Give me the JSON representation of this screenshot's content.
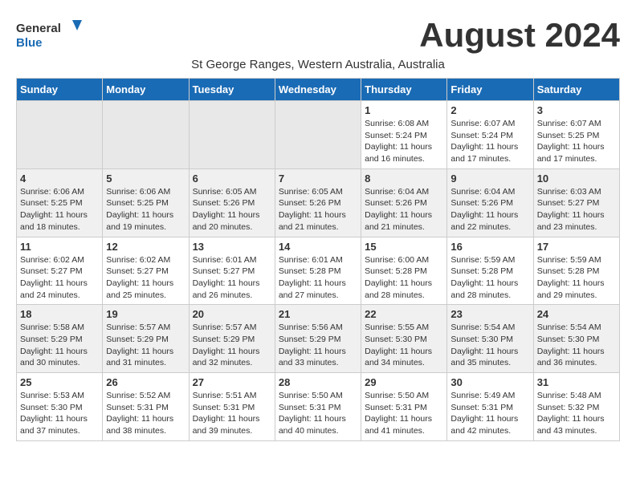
{
  "header": {
    "logo_general": "General",
    "logo_blue": "Blue",
    "month_title": "August 2024",
    "subtitle": "St George Ranges, Western Australia, Australia"
  },
  "days_of_week": [
    "Sunday",
    "Monday",
    "Tuesday",
    "Wednesday",
    "Thursday",
    "Friday",
    "Saturday"
  ],
  "weeks": [
    [
      {
        "day": "",
        "info": ""
      },
      {
        "day": "",
        "info": ""
      },
      {
        "day": "",
        "info": ""
      },
      {
        "day": "",
        "info": ""
      },
      {
        "day": "1",
        "info": "Sunrise: 6:08 AM\nSunset: 5:24 PM\nDaylight: 11 hours\nand 16 minutes."
      },
      {
        "day": "2",
        "info": "Sunrise: 6:07 AM\nSunset: 5:24 PM\nDaylight: 11 hours\nand 17 minutes."
      },
      {
        "day": "3",
        "info": "Sunrise: 6:07 AM\nSunset: 5:25 PM\nDaylight: 11 hours\nand 17 minutes."
      }
    ],
    [
      {
        "day": "4",
        "info": "Sunrise: 6:06 AM\nSunset: 5:25 PM\nDaylight: 11 hours\nand 18 minutes."
      },
      {
        "day": "5",
        "info": "Sunrise: 6:06 AM\nSunset: 5:25 PM\nDaylight: 11 hours\nand 19 minutes."
      },
      {
        "day": "6",
        "info": "Sunrise: 6:05 AM\nSunset: 5:26 PM\nDaylight: 11 hours\nand 20 minutes."
      },
      {
        "day": "7",
        "info": "Sunrise: 6:05 AM\nSunset: 5:26 PM\nDaylight: 11 hours\nand 21 minutes."
      },
      {
        "day": "8",
        "info": "Sunrise: 6:04 AM\nSunset: 5:26 PM\nDaylight: 11 hours\nand 21 minutes."
      },
      {
        "day": "9",
        "info": "Sunrise: 6:04 AM\nSunset: 5:26 PM\nDaylight: 11 hours\nand 22 minutes."
      },
      {
        "day": "10",
        "info": "Sunrise: 6:03 AM\nSunset: 5:27 PM\nDaylight: 11 hours\nand 23 minutes."
      }
    ],
    [
      {
        "day": "11",
        "info": "Sunrise: 6:02 AM\nSunset: 5:27 PM\nDaylight: 11 hours\nand 24 minutes."
      },
      {
        "day": "12",
        "info": "Sunrise: 6:02 AM\nSunset: 5:27 PM\nDaylight: 11 hours\nand 25 minutes."
      },
      {
        "day": "13",
        "info": "Sunrise: 6:01 AM\nSunset: 5:27 PM\nDaylight: 11 hours\nand 26 minutes."
      },
      {
        "day": "14",
        "info": "Sunrise: 6:01 AM\nSunset: 5:28 PM\nDaylight: 11 hours\nand 27 minutes."
      },
      {
        "day": "15",
        "info": "Sunrise: 6:00 AM\nSunset: 5:28 PM\nDaylight: 11 hours\nand 28 minutes."
      },
      {
        "day": "16",
        "info": "Sunrise: 5:59 AM\nSunset: 5:28 PM\nDaylight: 11 hours\nand 28 minutes."
      },
      {
        "day": "17",
        "info": "Sunrise: 5:59 AM\nSunset: 5:28 PM\nDaylight: 11 hours\nand 29 minutes."
      }
    ],
    [
      {
        "day": "18",
        "info": "Sunrise: 5:58 AM\nSunset: 5:29 PM\nDaylight: 11 hours\nand 30 minutes."
      },
      {
        "day": "19",
        "info": "Sunrise: 5:57 AM\nSunset: 5:29 PM\nDaylight: 11 hours\nand 31 minutes."
      },
      {
        "day": "20",
        "info": "Sunrise: 5:57 AM\nSunset: 5:29 PM\nDaylight: 11 hours\nand 32 minutes."
      },
      {
        "day": "21",
        "info": "Sunrise: 5:56 AM\nSunset: 5:29 PM\nDaylight: 11 hours\nand 33 minutes."
      },
      {
        "day": "22",
        "info": "Sunrise: 5:55 AM\nSunset: 5:30 PM\nDaylight: 11 hours\nand 34 minutes."
      },
      {
        "day": "23",
        "info": "Sunrise: 5:54 AM\nSunset: 5:30 PM\nDaylight: 11 hours\nand 35 minutes."
      },
      {
        "day": "24",
        "info": "Sunrise: 5:54 AM\nSunset: 5:30 PM\nDaylight: 11 hours\nand 36 minutes."
      }
    ],
    [
      {
        "day": "25",
        "info": "Sunrise: 5:53 AM\nSunset: 5:30 PM\nDaylight: 11 hours\nand 37 minutes."
      },
      {
        "day": "26",
        "info": "Sunrise: 5:52 AM\nSunset: 5:31 PM\nDaylight: 11 hours\nand 38 minutes."
      },
      {
        "day": "27",
        "info": "Sunrise: 5:51 AM\nSunset: 5:31 PM\nDaylight: 11 hours\nand 39 minutes."
      },
      {
        "day": "28",
        "info": "Sunrise: 5:50 AM\nSunset: 5:31 PM\nDaylight: 11 hours\nand 40 minutes."
      },
      {
        "day": "29",
        "info": "Sunrise: 5:50 AM\nSunset: 5:31 PM\nDaylight: 11 hours\nand 41 minutes."
      },
      {
        "day": "30",
        "info": "Sunrise: 5:49 AM\nSunset: 5:31 PM\nDaylight: 11 hours\nand 42 minutes."
      },
      {
        "day": "31",
        "info": "Sunrise: 5:48 AM\nSunset: 5:32 PM\nDaylight: 11 hours\nand 43 minutes."
      }
    ]
  ]
}
